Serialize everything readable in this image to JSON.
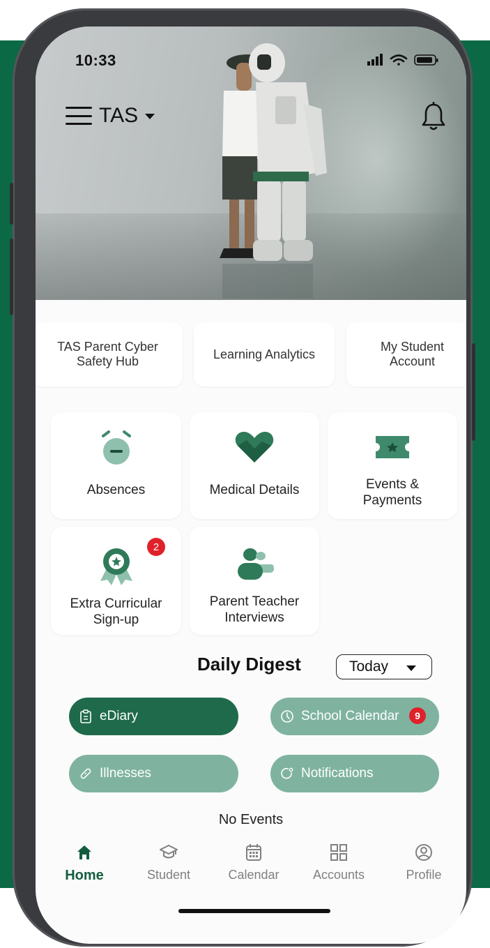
{
  "status_bar": {
    "time": "10:33"
  },
  "header": {
    "school_name": "TAS"
  },
  "quick_links": [
    {
      "label": "TAS Parent Cyber Safety Hub"
    },
    {
      "label": "Learning Analytics"
    },
    {
      "label": "My Student Account"
    }
  ],
  "tiles": [
    {
      "label": "Absences",
      "icon": "alarm-clock-icon"
    },
    {
      "label": "Medical Details",
      "icon": "heart-icon"
    },
    {
      "label": "Events & Payments",
      "icon": "ticket-icon"
    },
    {
      "label": "Extra Curricular Sign-up",
      "icon": "award-ribbon-icon",
      "badge": "2"
    },
    {
      "label": "Parent Teacher Interviews",
      "icon": "people-icon"
    }
  ],
  "digest": {
    "title": "Daily Digest",
    "filter": "Today",
    "chips": [
      {
        "label": "eDiary",
        "icon": "clipboard-icon"
      },
      {
        "label": "School Calendar",
        "icon": "calendar-circle-icon",
        "badge": "9"
      },
      {
        "label": "Illnesses",
        "icon": "bandage-icon"
      },
      {
        "label": "Notifications",
        "icon": "notification-icon"
      }
    ],
    "empty_text": "No Events"
  },
  "bottom_nav": [
    {
      "label": "Home",
      "icon": "home-icon"
    },
    {
      "label": "Student",
      "icon": "graduation-cap-icon"
    },
    {
      "label": "Calendar",
      "icon": "calendar-icon"
    },
    {
      "label": "Accounts",
      "icon": "grid-icon"
    },
    {
      "label": "Profile",
      "icon": "user-circle-icon"
    }
  ],
  "colors": {
    "brand_green": "#0b6a45",
    "tile_icon": "#3f8a6c",
    "pill_dark": "#1e6a4b",
    "pill_light": "#7fb3a0",
    "badge_red": "#e0212a"
  }
}
